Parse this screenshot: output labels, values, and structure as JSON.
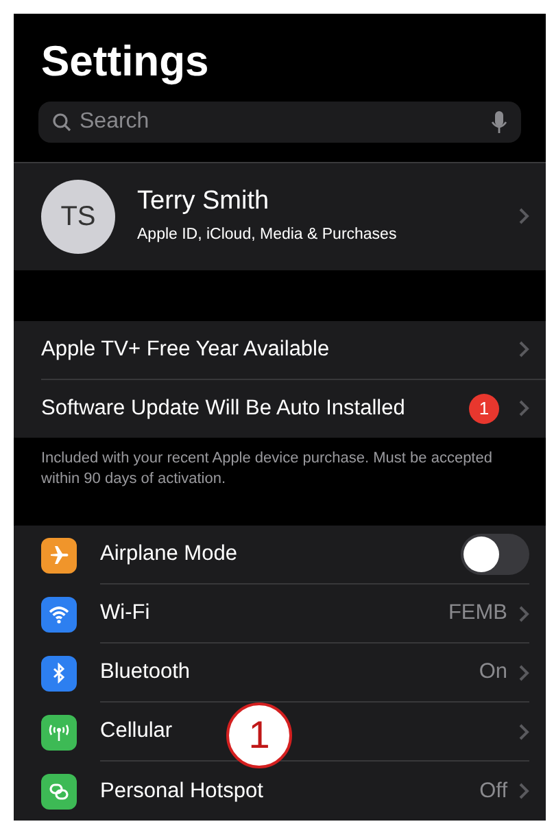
{
  "title": "Settings",
  "search": {
    "placeholder": "Search"
  },
  "profile": {
    "initials": "TS",
    "name": "Terry Smith",
    "subtitle": "Apple ID, iCloud, Media & Purchases"
  },
  "notices": [
    {
      "label": "Apple TV+ Free Year Available"
    },
    {
      "label": "Software Update Will Be Auto Installed",
      "badge": "1"
    }
  ],
  "notice_footer": "Included with your recent Apple device purchase. Must be accepted within 90 days of activation.",
  "network_rows": [
    {
      "kind": "toggle",
      "label": "Airplane Mode",
      "color": "#f0952b",
      "on": false
    },
    {
      "kind": "link",
      "label": "Wi-Fi",
      "color": "#2d7ff0",
      "value": "FEMB"
    },
    {
      "kind": "link",
      "label": "Bluetooth",
      "color": "#2d7ff0",
      "value": "On"
    },
    {
      "kind": "link",
      "label": "Cellular",
      "color": "#3dba55"
    },
    {
      "kind": "link",
      "label": "Personal Hotspot",
      "color": "#3dba55",
      "value": "Off"
    }
  ],
  "callout": {
    "text": "1"
  }
}
